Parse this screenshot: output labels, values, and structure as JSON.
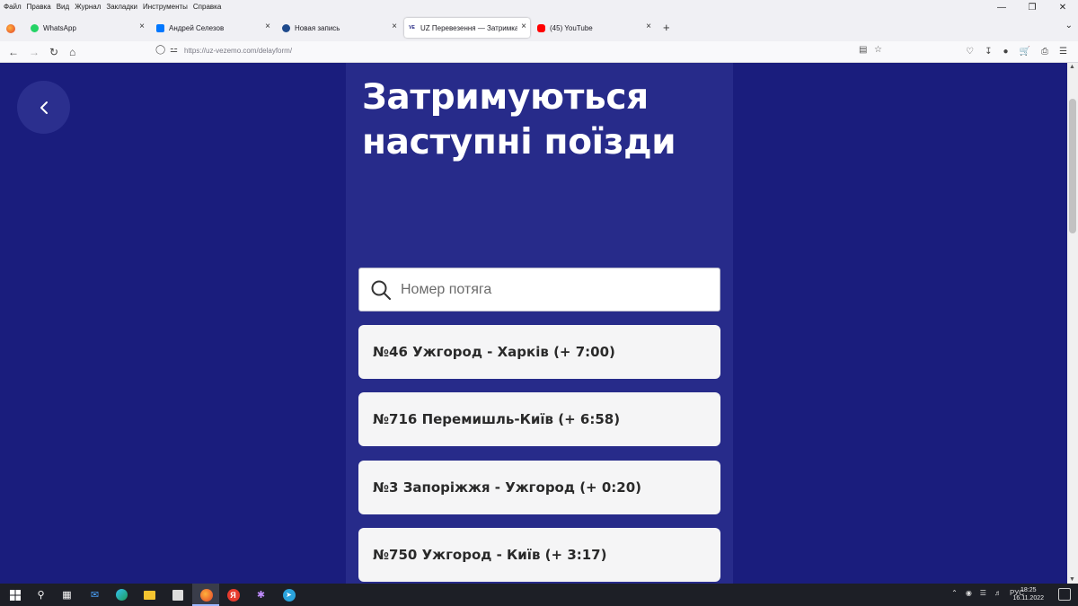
{
  "menubar": {
    "items": [
      "Файл",
      "Правка",
      "Вид",
      "Журнал",
      "Закладки",
      "Инструменты",
      "Справка"
    ]
  },
  "tabs": [
    {
      "label": "WhatsApp",
      "favicon_color": "#25d366"
    },
    {
      "label": "Андрей Селезов",
      "favicon_color": "#0077ff"
    },
    {
      "label": "Новая запись",
      "favicon_color": "#1e4a8c"
    },
    {
      "label": "UZ Перевезення — Затримка",
      "favicon_color": "#ffffff",
      "favicon_text": "VE"
    },
    {
      "label": "(45) YouTube",
      "favicon_color": "#ff0000"
    }
  ],
  "navbar": {
    "url": "https://uz-vezemo.com/delayform/"
  },
  "page": {
    "title": "Затримуються наступні поїзди",
    "search_placeholder": "Номер потяга",
    "trains": [
      {
        "label": "№46 Ужгород - Харків (+ 7:00)"
      },
      {
        "label": "№716 Перемишль-Київ (+ 6:58)"
      },
      {
        "label": "№3 Запоріжжя - Ужгород (+ 0:20)"
      },
      {
        "label": "№750 Ужгород - Київ (+ 3:17)"
      }
    ]
  },
  "taskbar": {
    "language": "РУС",
    "time": "18:25",
    "date": "16.11.2022"
  },
  "colors": {
    "page_bg": "#1a1d7d",
    "panel_bg": "#272b8a",
    "card_bg": "#f5f5f6",
    "back_button_bg": "#2b2f8e"
  }
}
